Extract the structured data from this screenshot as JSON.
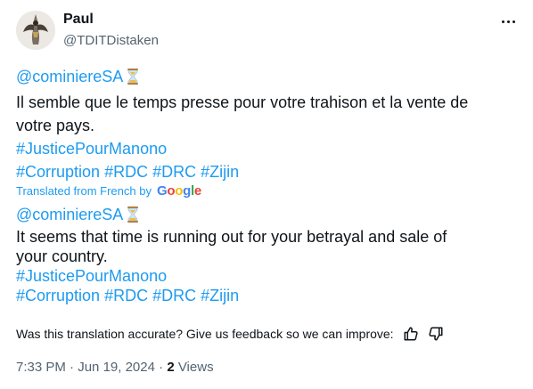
{
  "author": {
    "display_name": "Paul",
    "handle": "@TDITDistaken"
  },
  "original": {
    "mention": "@cominiereSA",
    "text_line1": "Il semble que le temps presse pour votre trahison et la vente de",
    "text_line2": "votre pays.",
    "hashtag_line1": "#JusticePourManono",
    "hashtags_line2": [
      "#Corruption",
      "#RDC",
      "#DRC",
      "#Zijin"
    ]
  },
  "translation_notice": {
    "label": "Translated from French by",
    "provider": "Google"
  },
  "translated": {
    "mention": "@cominiereSA",
    "text_line1": "It seems that time is running out for your betrayal and sale of",
    "text_line2": "your country.",
    "hashtag_line1": "#JusticePourManono",
    "hashtags_line2": [
      "#Corruption",
      "#RDC",
      "#DRC",
      "#Zijin"
    ]
  },
  "feedback": {
    "prompt": "Was this translation accurate? Give us feedback so we can improve:"
  },
  "meta": {
    "time": "7:33 PM",
    "separator": "·",
    "date": "Jun 19, 2024",
    "views_count": "2",
    "views_label": "Views"
  },
  "icons": {
    "more": "more-icon",
    "hourglass": "hourglass-emoji",
    "thumbs_up": "thumbs-up-icon",
    "thumbs_down": "thumbs-down-icon"
  },
  "colors": {
    "link": "#1d9bf0",
    "secondary_text": "#536471",
    "primary_text": "#0f1419"
  }
}
